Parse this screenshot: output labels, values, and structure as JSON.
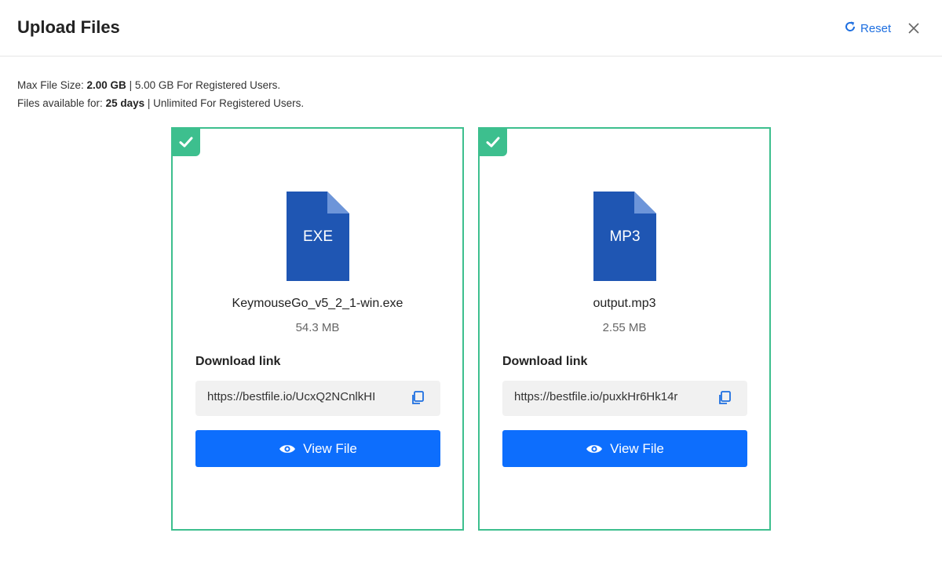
{
  "header": {
    "title": "Upload Files",
    "reset_label": "Reset"
  },
  "info": {
    "max_size_prefix": "Max File Size: ",
    "max_size_value": "2.00 GB",
    "max_size_suffix": " | 5.00 GB For Registered Users.",
    "avail_prefix": "Files available for: ",
    "avail_value": "25 days",
    "avail_suffix": " | Unlimited For Registered Users."
  },
  "files": [
    {
      "type_label": "EXE",
      "name": "KeymouseGo_v5_2_1-win.exe",
      "size": "54.3 MB",
      "download_label": "Download link",
      "link": "https://bestfile.io/UcxQ2NCnlkHI",
      "view_label": "View File"
    },
    {
      "type_label": "MP3",
      "name": "output.mp3",
      "size": "2.55 MB",
      "download_label": "Download link",
      "link": "https://bestfile.io/puxkHr6Hk14r",
      "view_label": "View File"
    }
  ],
  "colors": {
    "accent_blue": "#0d6efd",
    "success_green": "#3dbf8e",
    "file_icon_blue": "#1f56b3",
    "link_blue": "#1e6fe0"
  },
  "icons": {
    "reset": "refresh-icon",
    "close": "close-icon",
    "check": "check-icon",
    "file": "file-icon",
    "copy": "copy-icon",
    "view": "eye-icon"
  }
}
